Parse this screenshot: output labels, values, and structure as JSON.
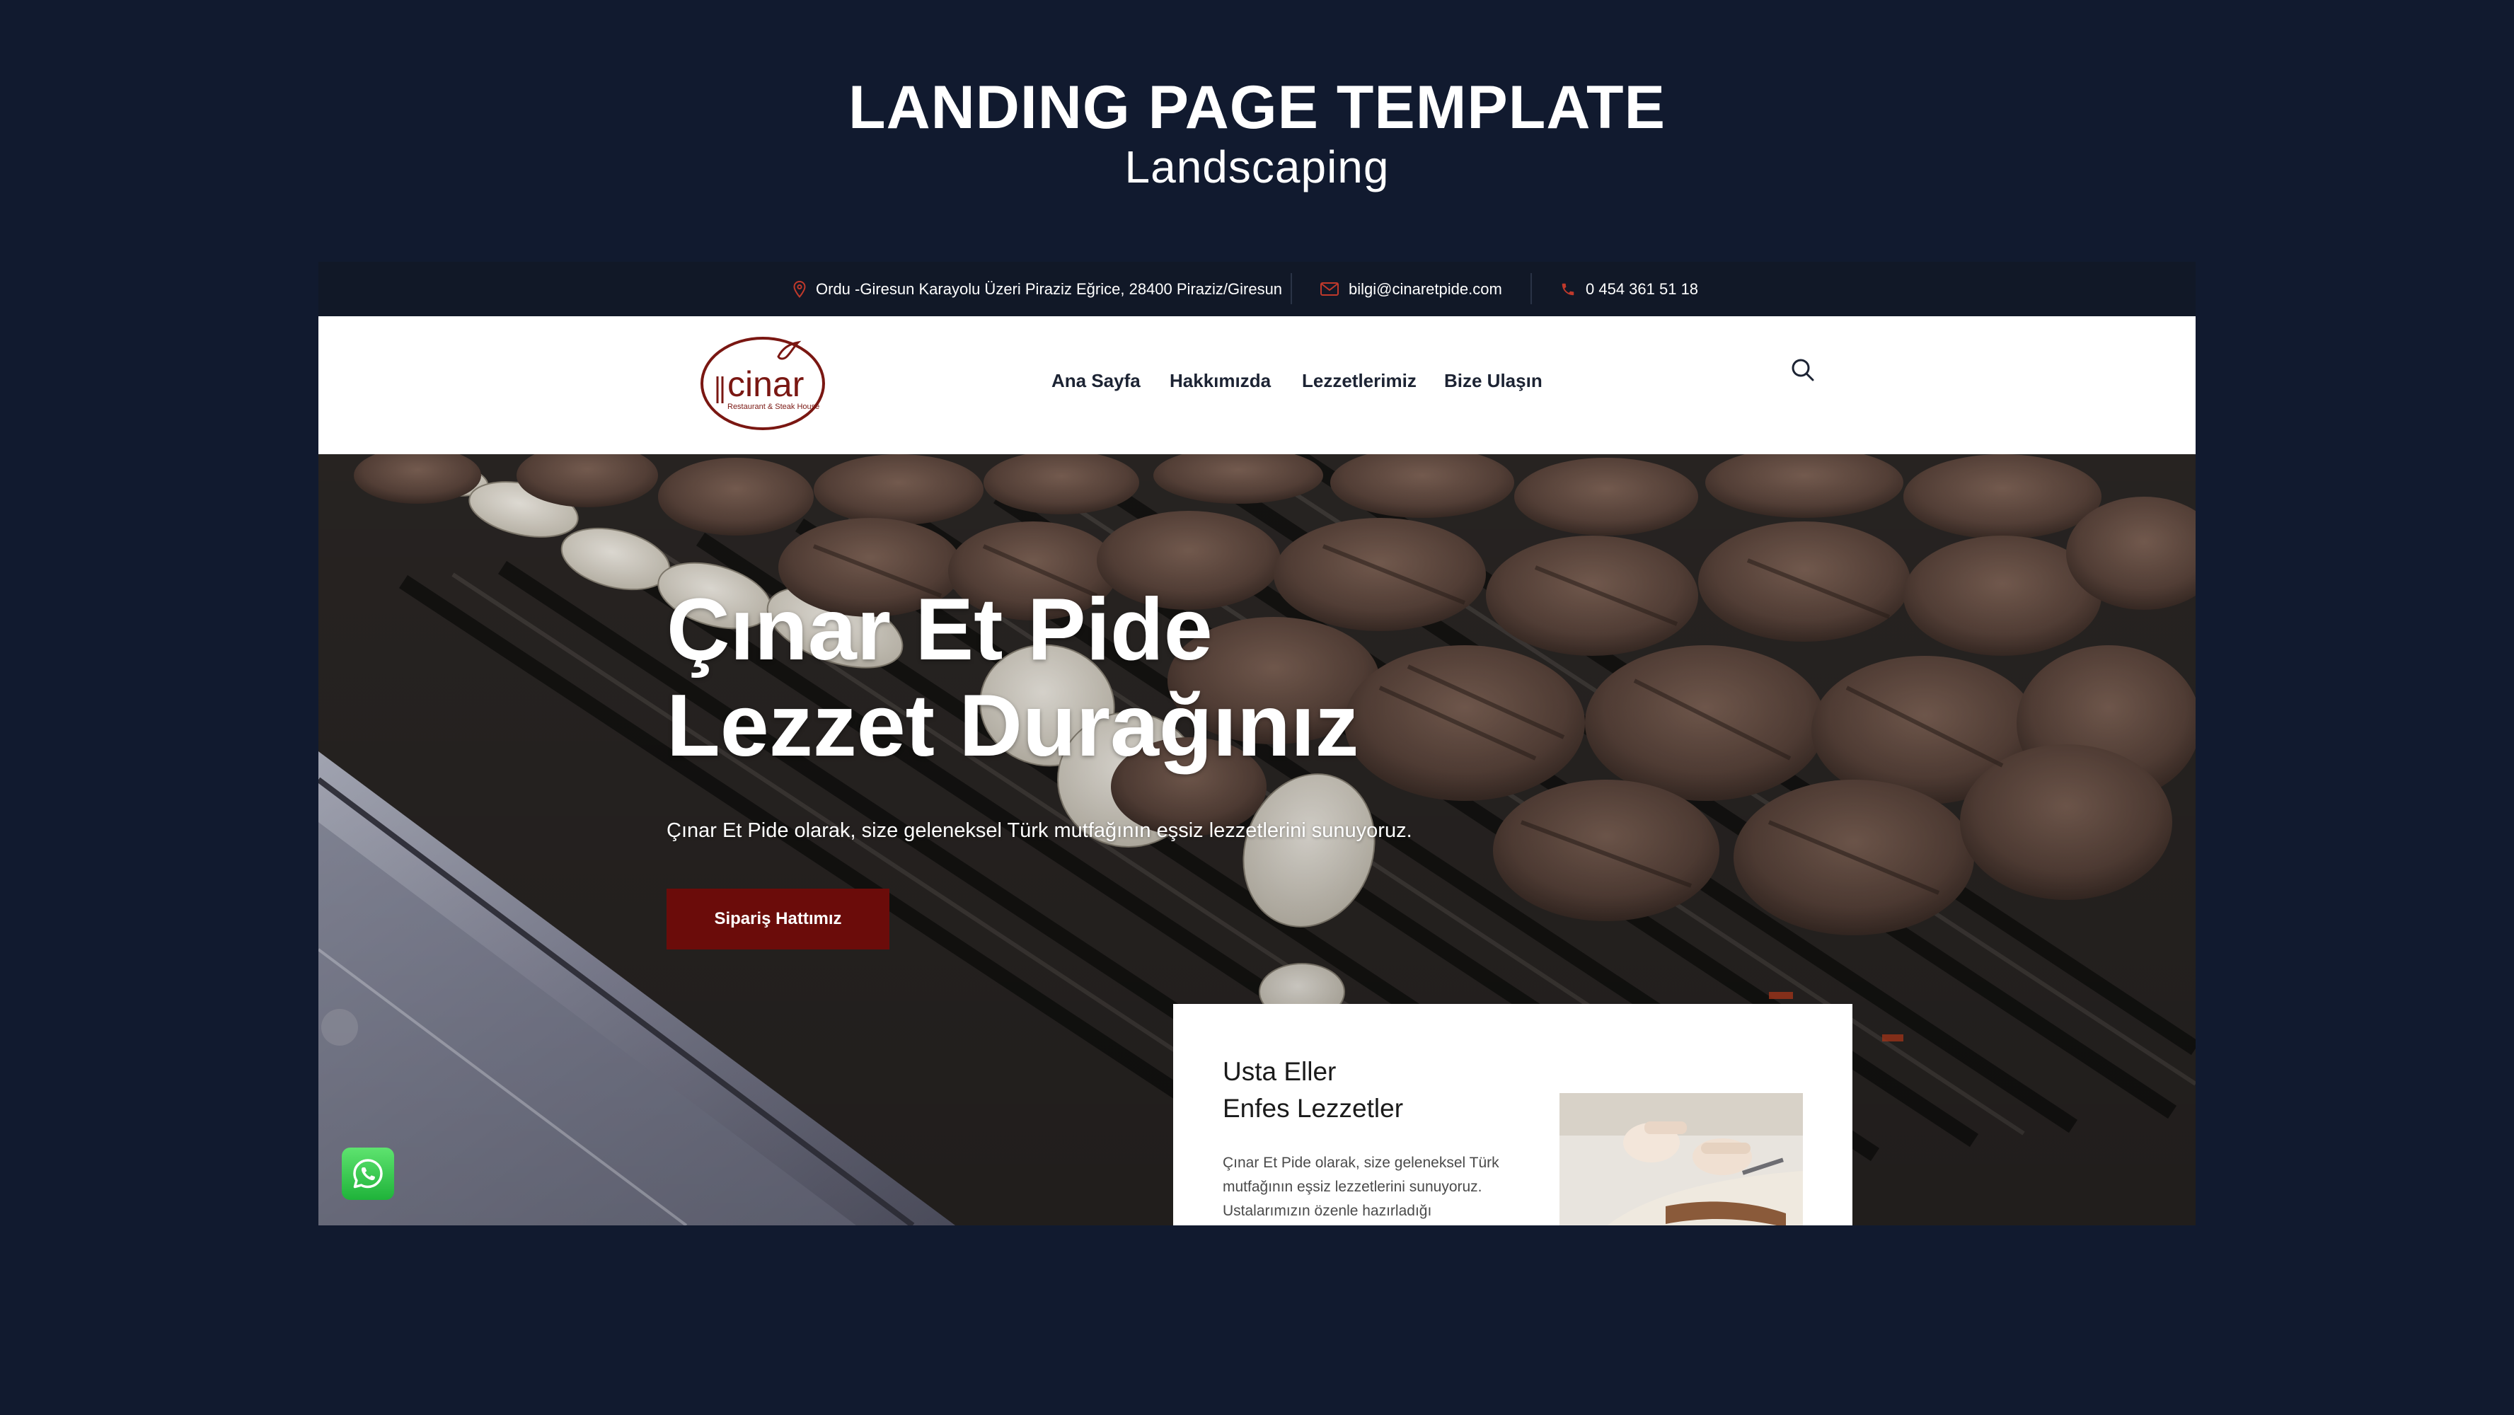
{
  "presentation": {
    "title": "LANDING PAGE TEMPLATE",
    "subtitle": "Landscaping"
  },
  "topbar": {
    "address": "Ordu -Giresun Karayolu Üzeri Piraziz Eğrice, 28400 Piraziz/Giresun",
    "email": "bilgi@cinaretpide.com",
    "phone": "0 454 361 51 18"
  },
  "brand": {
    "logo_name": "cinar",
    "logo_tagline": "Restaurant & Steak House"
  },
  "nav": {
    "items": [
      "Ana Sayfa",
      "Hakkımızda",
      "Lezzetlerimiz",
      "Bize Ulaşın"
    ]
  },
  "hero": {
    "title_line1": "Çınar Et Pide",
    "title_line2": "Lezzet Durağınız",
    "description": "Çınar Et Pide olarak, size geleneksel Türk mutfağının eşsiz lezzetlerini sunuyoruz.",
    "button_label": "Sipariş Hattımız"
  },
  "card": {
    "title_line1": "Usta Eller",
    "title_line2": "Enfes Lezzetler",
    "text": "Çınar Et Pide olarak, size geleneksel Türk mutfağının eşsiz lezzetlerini sunuyoruz. Ustalarımızın özenle hazırladığı"
  },
  "icons": {
    "location": "location-pin-icon",
    "email": "envelope-icon",
    "phone": "phone-icon",
    "search": "search-icon",
    "whatsapp": "whatsapp-icon"
  },
  "colors": {
    "page_background": "#111a2f",
    "topbar_background": "#111827",
    "accent_red": "#6b0c0a",
    "icon_red": "#c0392b",
    "whatsapp_green": "#25d366"
  }
}
